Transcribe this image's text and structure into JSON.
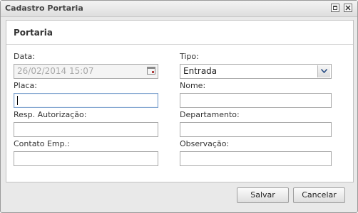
{
  "window": {
    "title": "Cadastro Portaria"
  },
  "panel": {
    "title": "Portaria"
  },
  "form": {
    "data": {
      "label": "Data:",
      "value": "26/02/2014 15:07"
    },
    "tipo": {
      "label": "Tipo:",
      "value": "Entrada"
    },
    "placa": {
      "label": "Placa:",
      "value": ""
    },
    "nome": {
      "label": "Nome:",
      "value": ""
    },
    "resp_autorizacao": {
      "label": "Resp. Autorização:",
      "value": ""
    },
    "departamento": {
      "label": "Departamento:",
      "value": ""
    },
    "contato_emp": {
      "label": "Contato Emp.:",
      "value": ""
    },
    "observacao": {
      "label": "Observação:",
      "value": ""
    }
  },
  "buttons": {
    "save": "Salvar",
    "cancel": "Cancelar"
  },
  "icons": {
    "maximize": "maximize-icon",
    "close": "close-icon",
    "calendar": "calendar-icon",
    "dropdown": "chevron-down-icon"
  },
  "colors": {
    "focus_border": "#7da2ce",
    "disabled_text": "#a8a8a8",
    "window_bg": "#e9e9e9"
  }
}
